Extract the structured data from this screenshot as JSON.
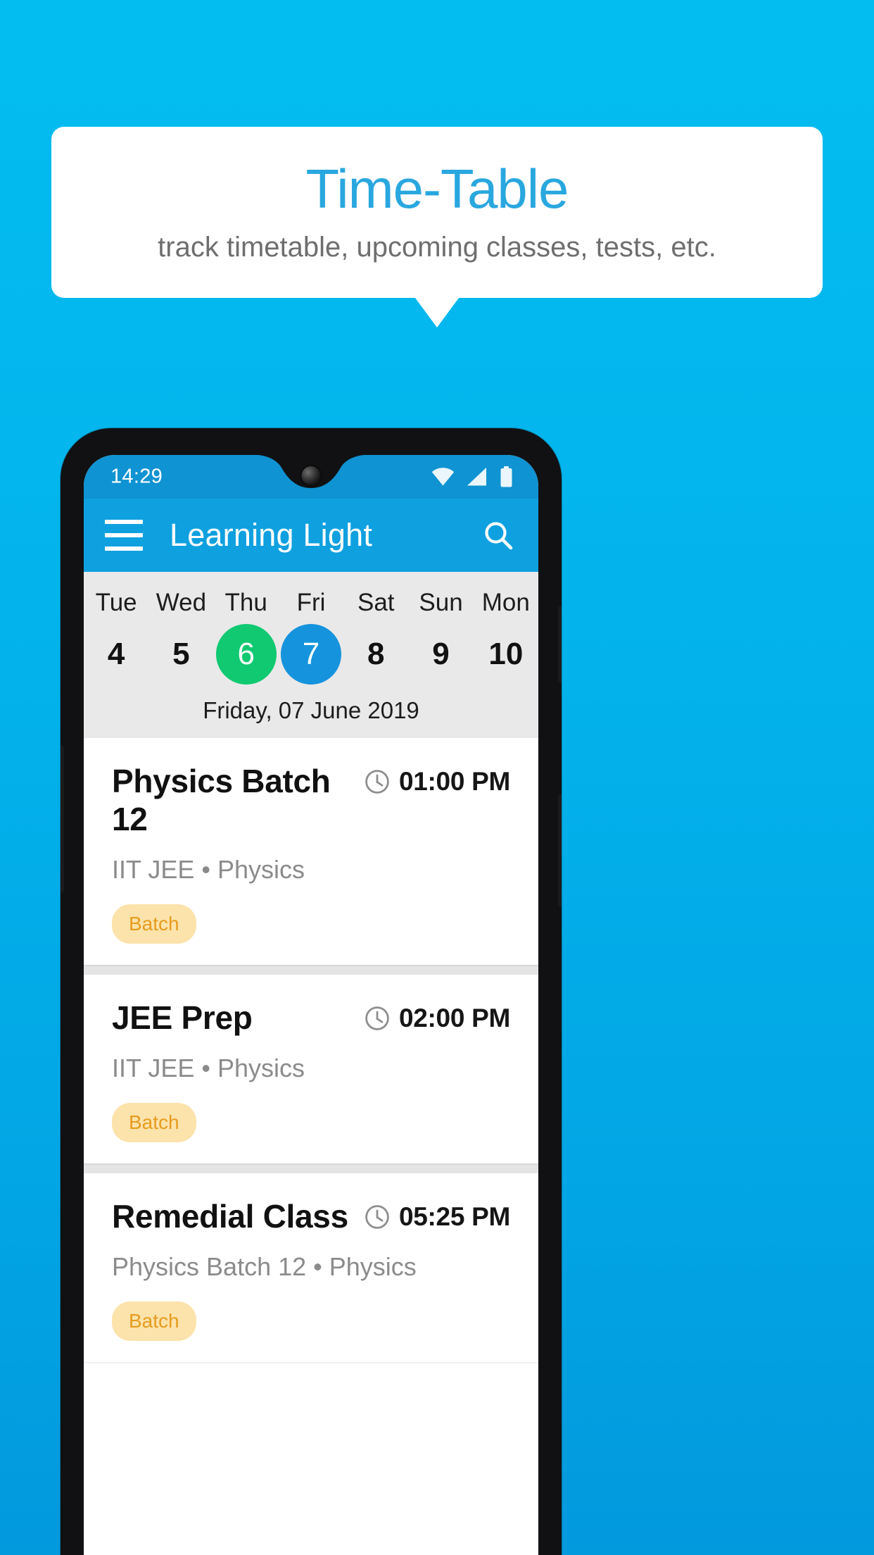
{
  "promo": {
    "title": "Time-Table",
    "subtitle": "track timetable, upcoming classes, tests, etc.",
    "title_color": "#29a7df",
    "subtitle_color": "#6e6e6e"
  },
  "background": {
    "color_top": "#03bdf0",
    "color_bottom": "#0299dd"
  },
  "phone": {
    "statusbar": {
      "time": "14:29",
      "icons": [
        "wifi-icon",
        "signal-icon",
        "battery-icon"
      ],
      "background": "#0f93d2"
    },
    "appbar": {
      "title": "Learning Light",
      "menu_icon": "hamburger-menu-icon",
      "search_icon": "search-icon",
      "background": "#0fa0e0"
    },
    "datestrip": {
      "background": "#e9e9e9",
      "days": [
        {
          "name": "Tue",
          "num": "4",
          "state": "normal"
        },
        {
          "name": "Wed",
          "num": "5",
          "state": "normal"
        },
        {
          "name": "Thu",
          "num": "6",
          "state": "marked"
        },
        {
          "name": "Fri",
          "num": "7",
          "state": "selected"
        },
        {
          "name": "Sat",
          "num": "8",
          "state": "normal"
        },
        {
          "name": "Sun",
          "num": "9",
          "state": "normal"
        },
        {
          "name": "Mon",
          "num": "10",
          "state": "normal"
        }
      ],
      "marked_color": "#10c971",
      "selected_color": "#1693dd",
      "full_date": "Friday, 07 June 2019"
    },
    "classes": [
      {
        "title": "Physics Batch 12",
        "time": "01:00 PM",
        "time_icon": "clock-icon",
        "subtitle": "IIT JEE • Physics",
        "badge": "Batch"
      },
      {
        "title": "JEE Prep",
        "time": "02:00 PM",
        "time_icon": "clock-icon",
        "subtitle": "IIT JEE • Physics",
        "badge": "Batch"
      },
      {
        "title": "Remedial Class",
        "time": "05:25 PM",
        "time_icon": "clock-icon",
        "subtitle": "Physics Batch 12 • Physics",
        "badge": "Batch"
      }
    ],
    "badge_bg": "#fce3ab",
    "badge_fg": "#e79c20"
  }
}
